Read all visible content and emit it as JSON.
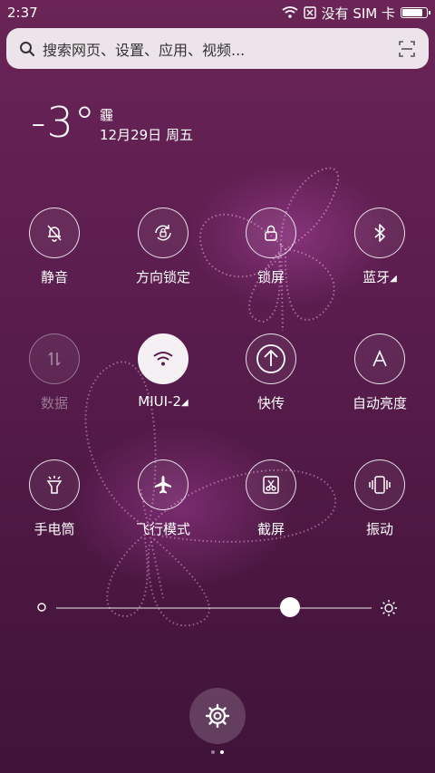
{
  "status_bar": {
    "time": "2:37",
    "carrier": "没有 SIM 卡",
    "battery_percent": 80
  },
  "search": {
    "placeholder": "搜索网页、设置、应用、视频..."
  },
  "weather": {
    "temperature": "-3°",
    "condition": "霾",
    "date": "12月29日 周五"
  },
  "toggles": [
    {
      "label": "静音",
      "icon": "silent-bell-icon",
      "active": false
    },
    {
      "label": "方向锁定",
      "icon": "rotation-lock-icon",
      "active": false
    },
    {
      "label": "锁屏",
      "icon": "lock-icon",
      "active": false
    },
    {
      "label": "蓝牙",
      "icon": "bluetooth-icon",
      "active": false,
      "has_more": true
    },
    {
      "label": "数据",
      "icon": "data-icon",
      "active": false,
      "disabled": true
    },
    {
      "label": "MIUI-2",
      "icon": "wifi-icon",
      "active": true,
      "has_more": true
    },
    {
      "label": "快传",
      "icon": "transfer-icon",
      "active": false
    },
    {
      "label": "自动亮度",
      "icon": "auto-brightness-icon",
      "active": false
    },
    {
      "label": "手电筒",
      "icon": "flashlight-icon",
      "active": false
    },
    {
      "label": "飞行模式",
      "icon": "airplane-icon",
      "active": false
    },
    {
      "label": "截屏",
      "icon": "screenshot-icon",
      "active": false
    },
    {
      "label": "振动",
      "icon": "vibrate-icon",
      "active": false
    }
  ],
  "brightness": {
    "level": 0.74
  },
  "page_indicator": {
    "pages": 2,
    "current": 2
  },
  "colors": {
    "background": "#5a1d4e",
    "accent": "#f4f0f3"
  }
}
